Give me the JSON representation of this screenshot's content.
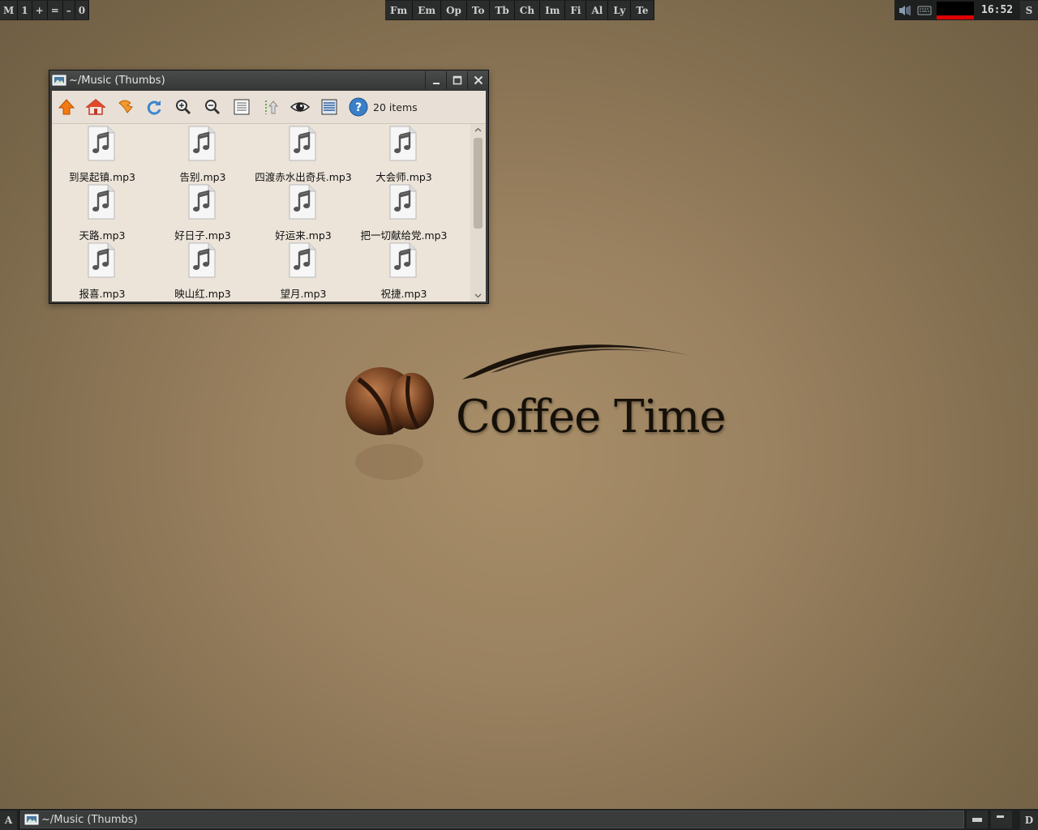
{
  "top_bar": {
    "left_buttons": [
      "M",
      "1",
      "+",
      "=",
      "–",
      "0"
    ],
    "app_buttons": [
      "Fm",
      "Em",
      "Op",
      "To",
      "Tb",
      "Ch",
      "Im",
      "Fi",
      "Al",
      "Ly",
      "Te"
    ],
    "tray_icons": [
      "volume-icon",
      "keyboard-icon"
    ],
    "clock": "16:52",
    "show_desktop": "S",
    "graph_color": "#e00000"
  },
  "window": {
    "title": "~/Music (Thumbs)",
    "controls": [
      "minimize-icon",
      "maximize-icon",
      "close-icon"
    ],
    "toolbar": {
      "tools": [
        "up-icon",
        "home-icon",
        "back-icon",
        "reload-icon",
        "zoom-in-icon",
        "zoom-out-icon",
        "list-view-icon",
        "sort-icon",
        "preview-eye-icon",
        "details-icon",
        "help-icon"
      ],
      "status": "20 items"
    },
    "files": [
      {
        "name": "到吴起镇.mp3"
      },
      {
        "name": "告别.mp3"
      },
      {
        "name": "四渡赤水出奇兵.mp3"
      },
      {
        "name": "大会师.mp3"
      },
      {
        "name": "天路.mp3"
      },
      {
        "name": "好日子.mp3"
      },
      {
        "name": "好运来.mp3"
      },
      {
        "name": "把一切献给党.mp3"
      },
      {
        "name": "报喜.mp3"
      },
      {
        "name": "映山红.mp3"
      },
      {
        "name": "望月.mp3"
      },
      {
        "name": "祝捷.mp3"
      }
    ]
  },
  "wallpaper": {
    "brand": "Coffee Time"
  },
  "bottom_bar": {
    "left": "A",
    "task_title": "~/Music (Thumbs)",
    "right": "D"
  }
}
